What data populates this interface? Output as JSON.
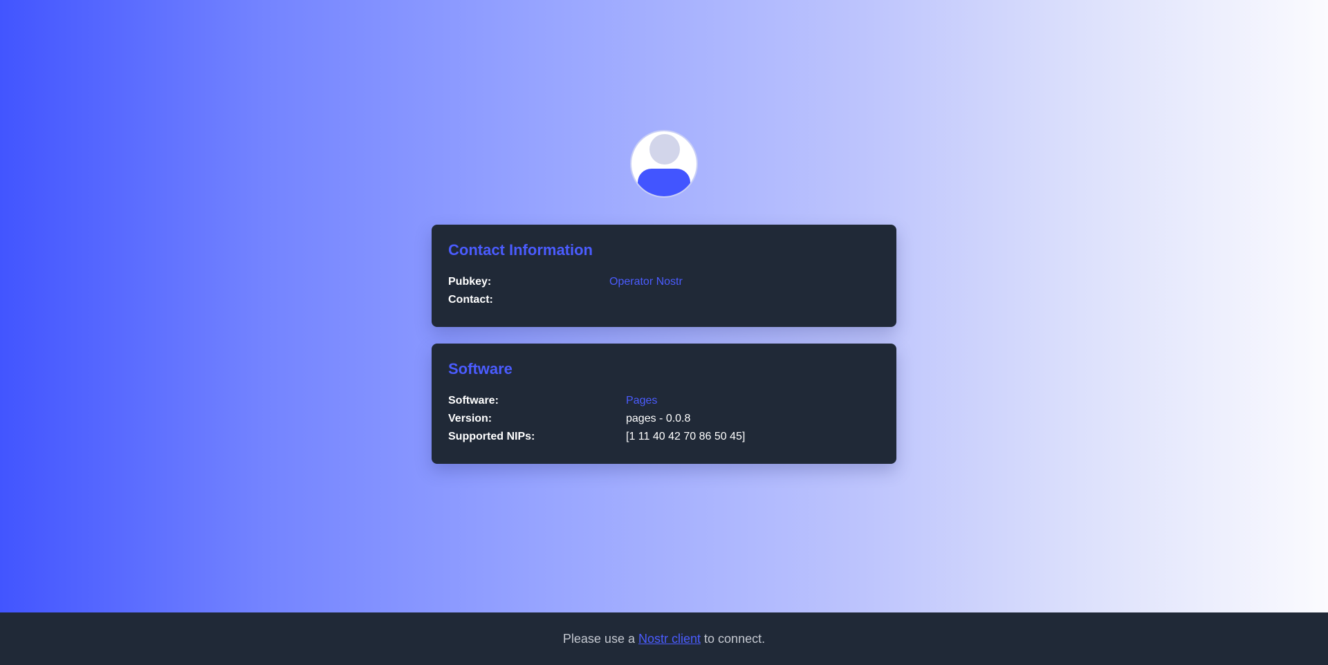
{
  "contact": {
    "title": "Contact Information",
    "pubkey_label": "Pubkey:",
    "pubkey_value": "Operator Nostr",
    "contact_label": "Contact:",
    "contact_value": ""
  },
  "software": {
    "title": "Software",
    "software_label": "Software:",
    "software_value": "Pages",
    "version_label": "Version:",
    "version_value": "pages - 0.0.8",
    "nips_label": "Supported NIPs:",
    "nips_value": "[1 11 40 42 70 86 50 45]"
  },
  "footer": {
    "prefix": "Please use a",
    "link": "Nostr client",
    "suffix": "to connect."
  },
  "icons": {
    "avatar": "user-avatar-icon"
  },
  "colors": {
    "accent": "#4b5cff",
    "card_bg": "#202937",
    "gradient_start": "#4255ff",
    "gradient_end": "#fbfbfe"
  }
}
